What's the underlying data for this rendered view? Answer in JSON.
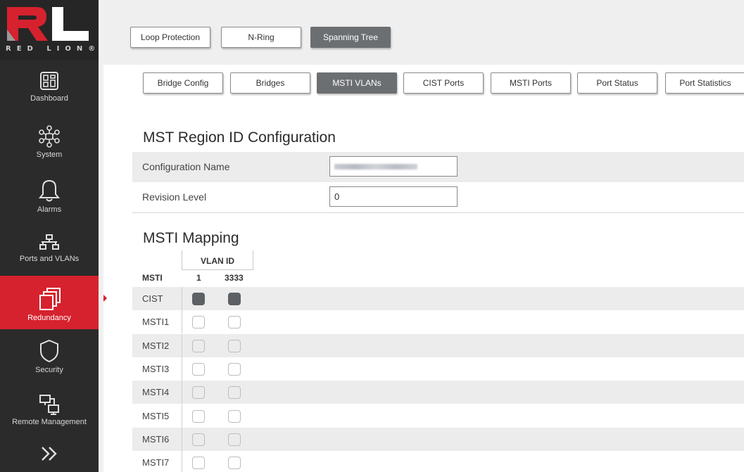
{
  "brand": {
    "logo_text": "RED LION®"
  },
  "colors": {
    "sidebar_bg": "#2b2b2b",
    "active_red": "#d6222e",
    "active_tab": "#6c6f72"
  },
  "sidebar": {
    "items": [
      {
        "label": "Dashboard",
        "icon": "dashboard-icon"
      },
      {
        "label": "System",
        "icon": "network-nodes-icon"
      },
      {
        "label": "Alarms",
        "icon": "bell-icon"
      },
      {
        "label": "Ports and VLANs",
        "icon": "ports-tree-icon"
      },
      {
        "label": "Redundancy",
        "icon": "stacked-windows-icon",
        "active": true
      },
      {
        "label": "Security",
        "icon": "shield-icon"
      },
      {
        "label": "Remote Management",
        "icon": "remote-monitors-icon"
      },
      {
        "label": "",
        "icon": "double-chevron-right-icon"
      }
    ]
  },
  "top_tabs": [
    "Loop Protection",
    "N-Ring",
    "Spanning Tree"
  ],
  "top_tab_active": "Spanning Tree",
  "sub_tabs": [
    "Bridge Config",
    "Bridges",
    "MSTI VLANs",
    "CIST Ports",
    "MSTI Ports",
    "Port Status",
    "Port Statistics"
  ],
  "sub_tab_active": "MSTI VLANs",
  "region": {
    "title": "MST Region ID Configuration",
    "config_name_label": "Configuration Name",
    "config_name_value": "",
    "revision_label": "Revision Level",
    "revision_value": "0"
  },
  "mapping": {
    "title": "MSTI Mapping",
    "vlan_header": "VLAN ID",
    "msti_header": "MSTI",
    "vlan_columns": [
      "1",
      "3333"
    ],
    "rows": [
      {
        "name": "CIST",
        "checked": [
          true,
          true
        ]
      },
      {
        "name": "MSTI1",
        "checked": [
          false,
          false
        ]
      },
      {
        "name": "MSTI2",
        "checked": [
          false,
          false
        ]
      },
      {
        "name": "MSTI3",
        "checked": [
          false,
          false
        ]
      },
      {
        "name": "MSTI4",
        "checked": [
          false,
          false
        ]
      },
      {
        "name": "MSTI5",
        "checked": [
          false,
          false
        ]
      },
      {
        "name": "MSTI6",
        "checked": [
          false,
          false
        ]
      },
      {
        "name": "MSTI7",
        "checked": [
          false,
          false
        ]
      }
    ]
  }
}
